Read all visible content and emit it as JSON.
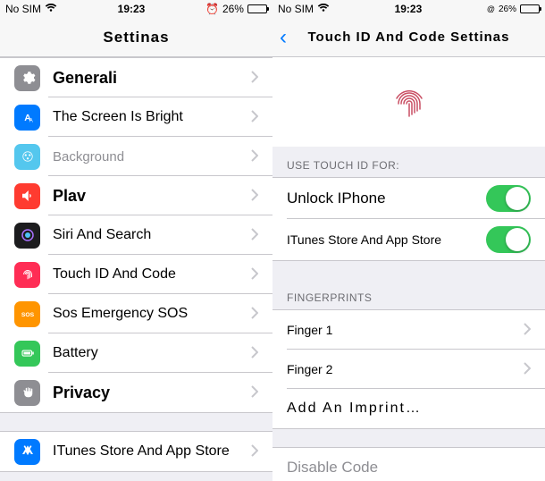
{
  "status": {
    "carrier": "No SIM",
    "time": "19:23",
    "battery_pct": "26%",
    "alarm_prefix": "⏰"
  },
  "left": {
    "title": "Settinas",
    "rows": [
      {
        "id": "general",
        "label": "Generali",
        "icon": "gear",
        "bold": true
      },
      {
        "id": "brightness",
        "label": "The Screen Is Bright",
        "icon": "brightness"
      },
      {
        "id": "wallpaper",
        "label": "Background",
        "icon": "wallpaper",
        "gray": true
      },
      {
        "id": "sounds",
        "label": "Plav",
        "icon": "sound",
        "bold": true
      },
      {
        "id": "siri",
        "label": "Siri And Search",
        "icon": "siri"
      },
      {
        "id": "touchid",
        "label": "Touch ID And Code",
        "icon": "fingerprint"
      },
      {
        "id": "sos",
        "label": "Sos Emergency SOS",
        "icon": "sos"
      },
      {
        "id": "battery",
        "label": "Battery",
        "icon": "battery"
      },
      {
        "id": "privacy",
        "label": "Privacy",
        "icon": "hand",
        "bold": true
      }
    ],
    "store_row": {
      "label": "ITunes Store And App Store",
      "icon": "appstore"
    }
  },
  "right": {
    "back_char": "‹",
    "title": "Touch ID And Code Settinas",
    "use_header": "USE TOUCH ID FOR:",
    "unlock_label": "Unlock IPhone",
    "itunes_label": "ITunes Store And App Store",
    "fingerprints_header": "FINGERPRINTS",
    "finger1": "Finger 1",
    "finger2": "Finger 2",
    "add_imprint": "Add An Imprint…",
    "disable": "Disable Code"
  }
}
